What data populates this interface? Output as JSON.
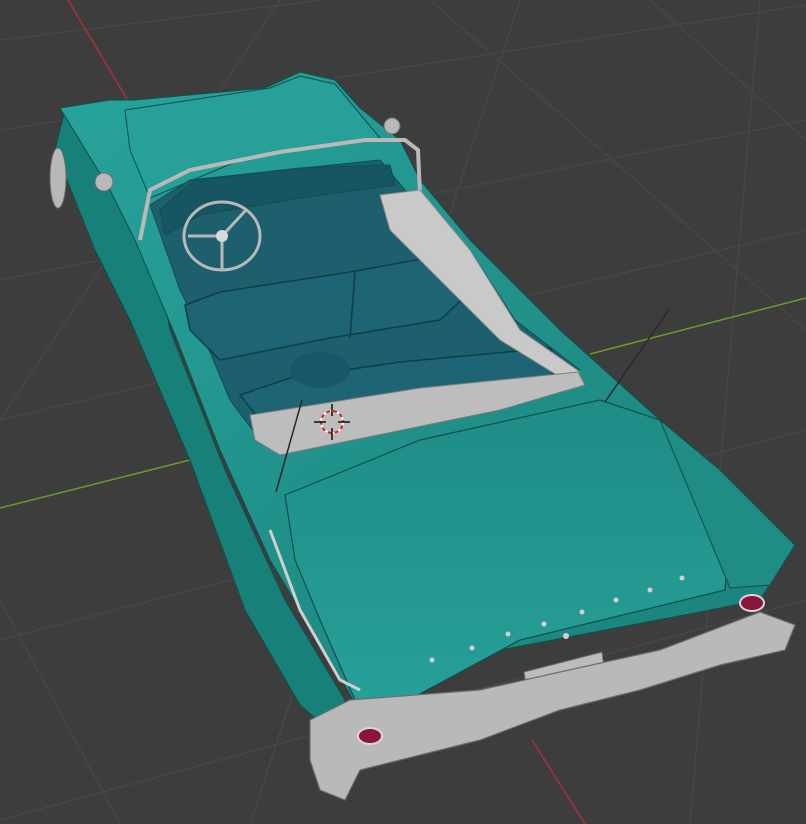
{
  "viewport": {
    "background_color": "#3d3d3d",
    "grid_color": "#4a4a4a",
    "x_axis_color": "#a8323a",
    "y_axis_color": "#6e9a28"
  },
  "model": {
    "body_color": "#21958f",
    "body_shadow_color": "#187872",
    "interior_color": "#1d5f6c",
    "chrome_color": "#b9b9b9",
    "taillight_color": "#8c1438"
  },
  "cursor": {
    "icon": "3d-cursor-icon"
  }
}
